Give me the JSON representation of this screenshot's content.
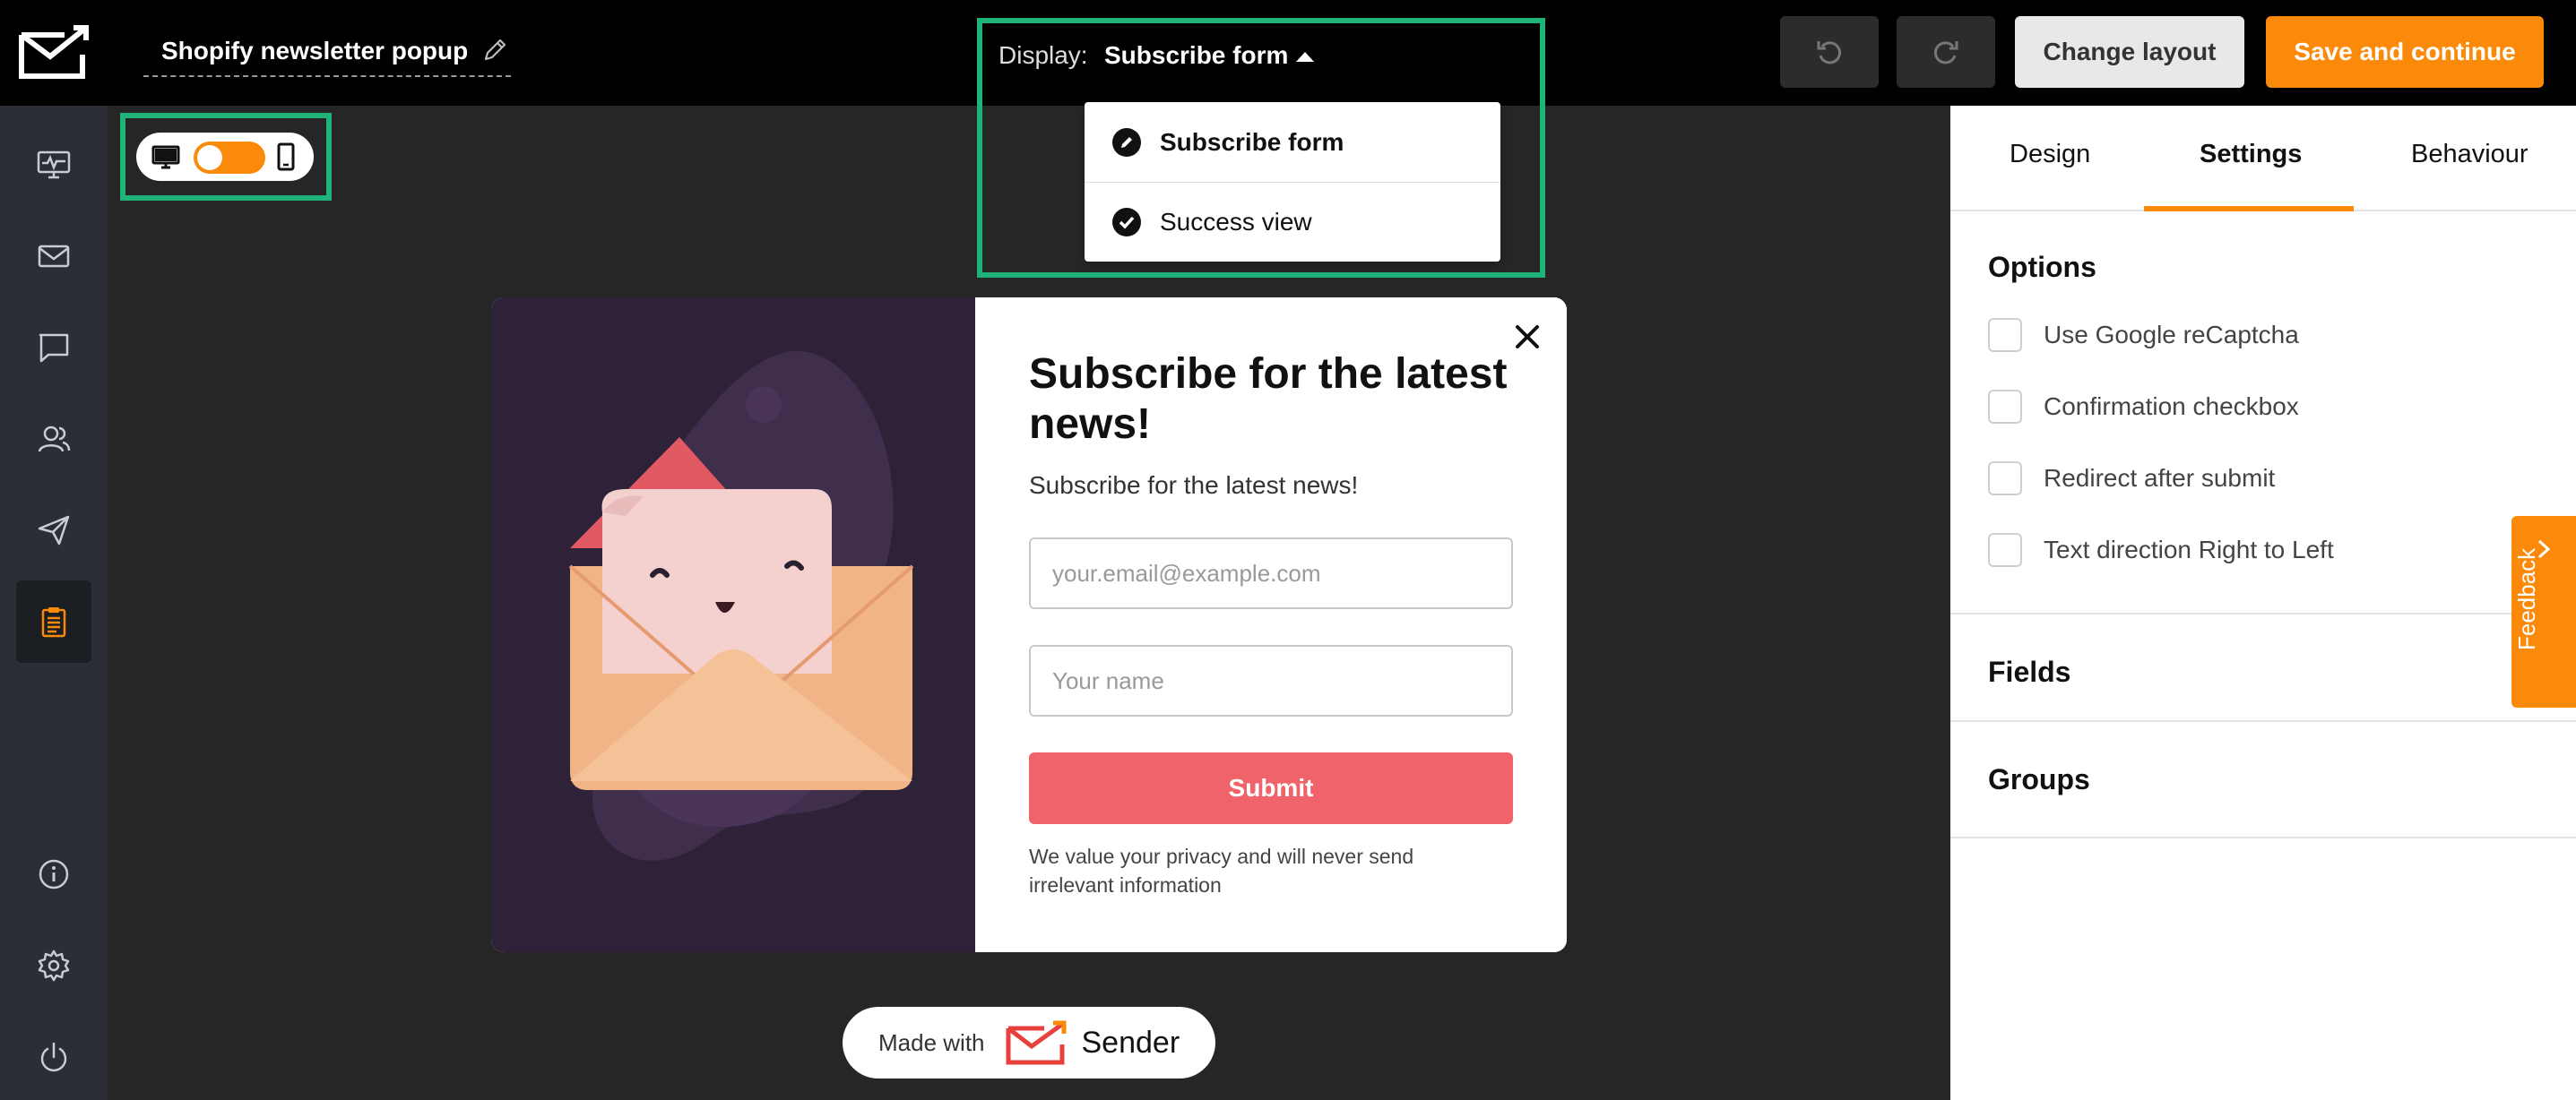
{
  "app": {
    "logo_icon": "envelope-check-logo-icon"
  },
  "sidebar": {
    "items": [
      {
        "icon": "dashboard-monitor-icon",
        "active": false
      },
      {
        "icon": "mail-icon",
        "active": false
      },
      {
        "icon": "chat-bubble-icon",
        "active": false
      },
      {
        "icon": "subscribers-icon",
        "active": false
      },
      {
        "icon": "paper-plane-icon",
        "active": false
      },
      {
        "icon": "forms-clipboard-icon",
        "active": true
      }
    ],
    "bottom_items": [
      {
        "icon": "info-icon"
      },
      {
        "icon": "gear-icon"
      },
      {
        "icon": "power-icon"
      }
    ]
  },
  "header": {
    "title": "Shopify newsletter popup",
    "display_label": "Display:",
    "display_value": "Subscribe form",
    "dropdown": [
      {
        "label": "Subscribe form",
        "icon": "pencil-circle-icon",
        "selected": true
      },
      {
        "label": "Success view",
        "icon": "check-circle-icon",
        "selected": false
      }
    ],
    "change_layout": "Change layout",
    "save": "Save and continue"
  },
  "device_toggle": {
    "mode": "desktop"
  },
  "popup": {
    "title": "Subscribe for the latest news!",
    "subtitle": "Subscribe for the latest news!",
    "email_placeholder": "your.email@example.com",
    "name_placeholder": "Your name",
    "submit": "Submit",
    "privacy": "We value your privacy and will never send irrelevant information"
  },
  "made_with": {
    "label": "Made with",
    "brand": "Sender"
  },
  "right_panel": {
    "tabs": [
      "Design",
      "Settings",
      "Behaviour"
    ],
    "active_tab": "Settings",
    "options_title": "Options",
    "options": [
      "Use Google reCaptcha",
      "Confirmation checkbox",
      "Redirect after submit",
      "Text direction Right to Left"
    ],
    "fields_title": "Fields",
    "groups_title": "Groups"
  },
  "feedback": "Feedback",
  "colors": {
    "accent": "#fb8a0a",
    "submit": "#f0636a",
    "highlight": "#1fb37a"
  }
}
